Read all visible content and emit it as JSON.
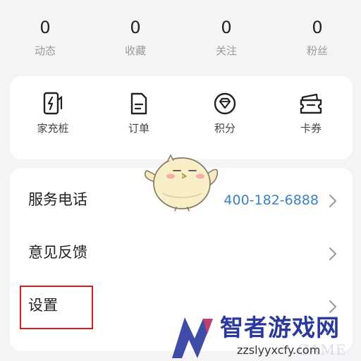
{
  "stats": [
    {
      "value": "0",
      "label": "动态"
    },
    {
      "value": "0",
      "label": "收藏"
    },
    {
      "value": "0",
      "label": "关注"
    },
    {
      "value": "0",
      "label": "粉丝"
    }
  ],
  "shortcuts": [
    {
      "label": "家充桩",
      "icon": "charger-icon"
    },
    {
      "label": "订单",
      "icon": "order-icon"
    },
    {
      "label": "积分",
      "icon": "points-icon"
    },
    {
      "label": "卡券",
      "icon": "coupon-icon"
    }
  ],
  "menu": [
    {
      "title": "服务电话",
      "value": "400-182-6888"
    },
    {
      "title": "意见反馈",
      "value": ""
    },
    {
      "title": "设置",
      "value": ""
    }
  ],
  "colors": {
    "accent": "#3b82c4",
    "highlight": "#e01b1b",
    "background": "#f4f4f6"
  },
  "watermark": {
    "title": "智者游戏网",
    "url": "zzslyyxcfy.com",
    "sub": "GAME"
  }
}
